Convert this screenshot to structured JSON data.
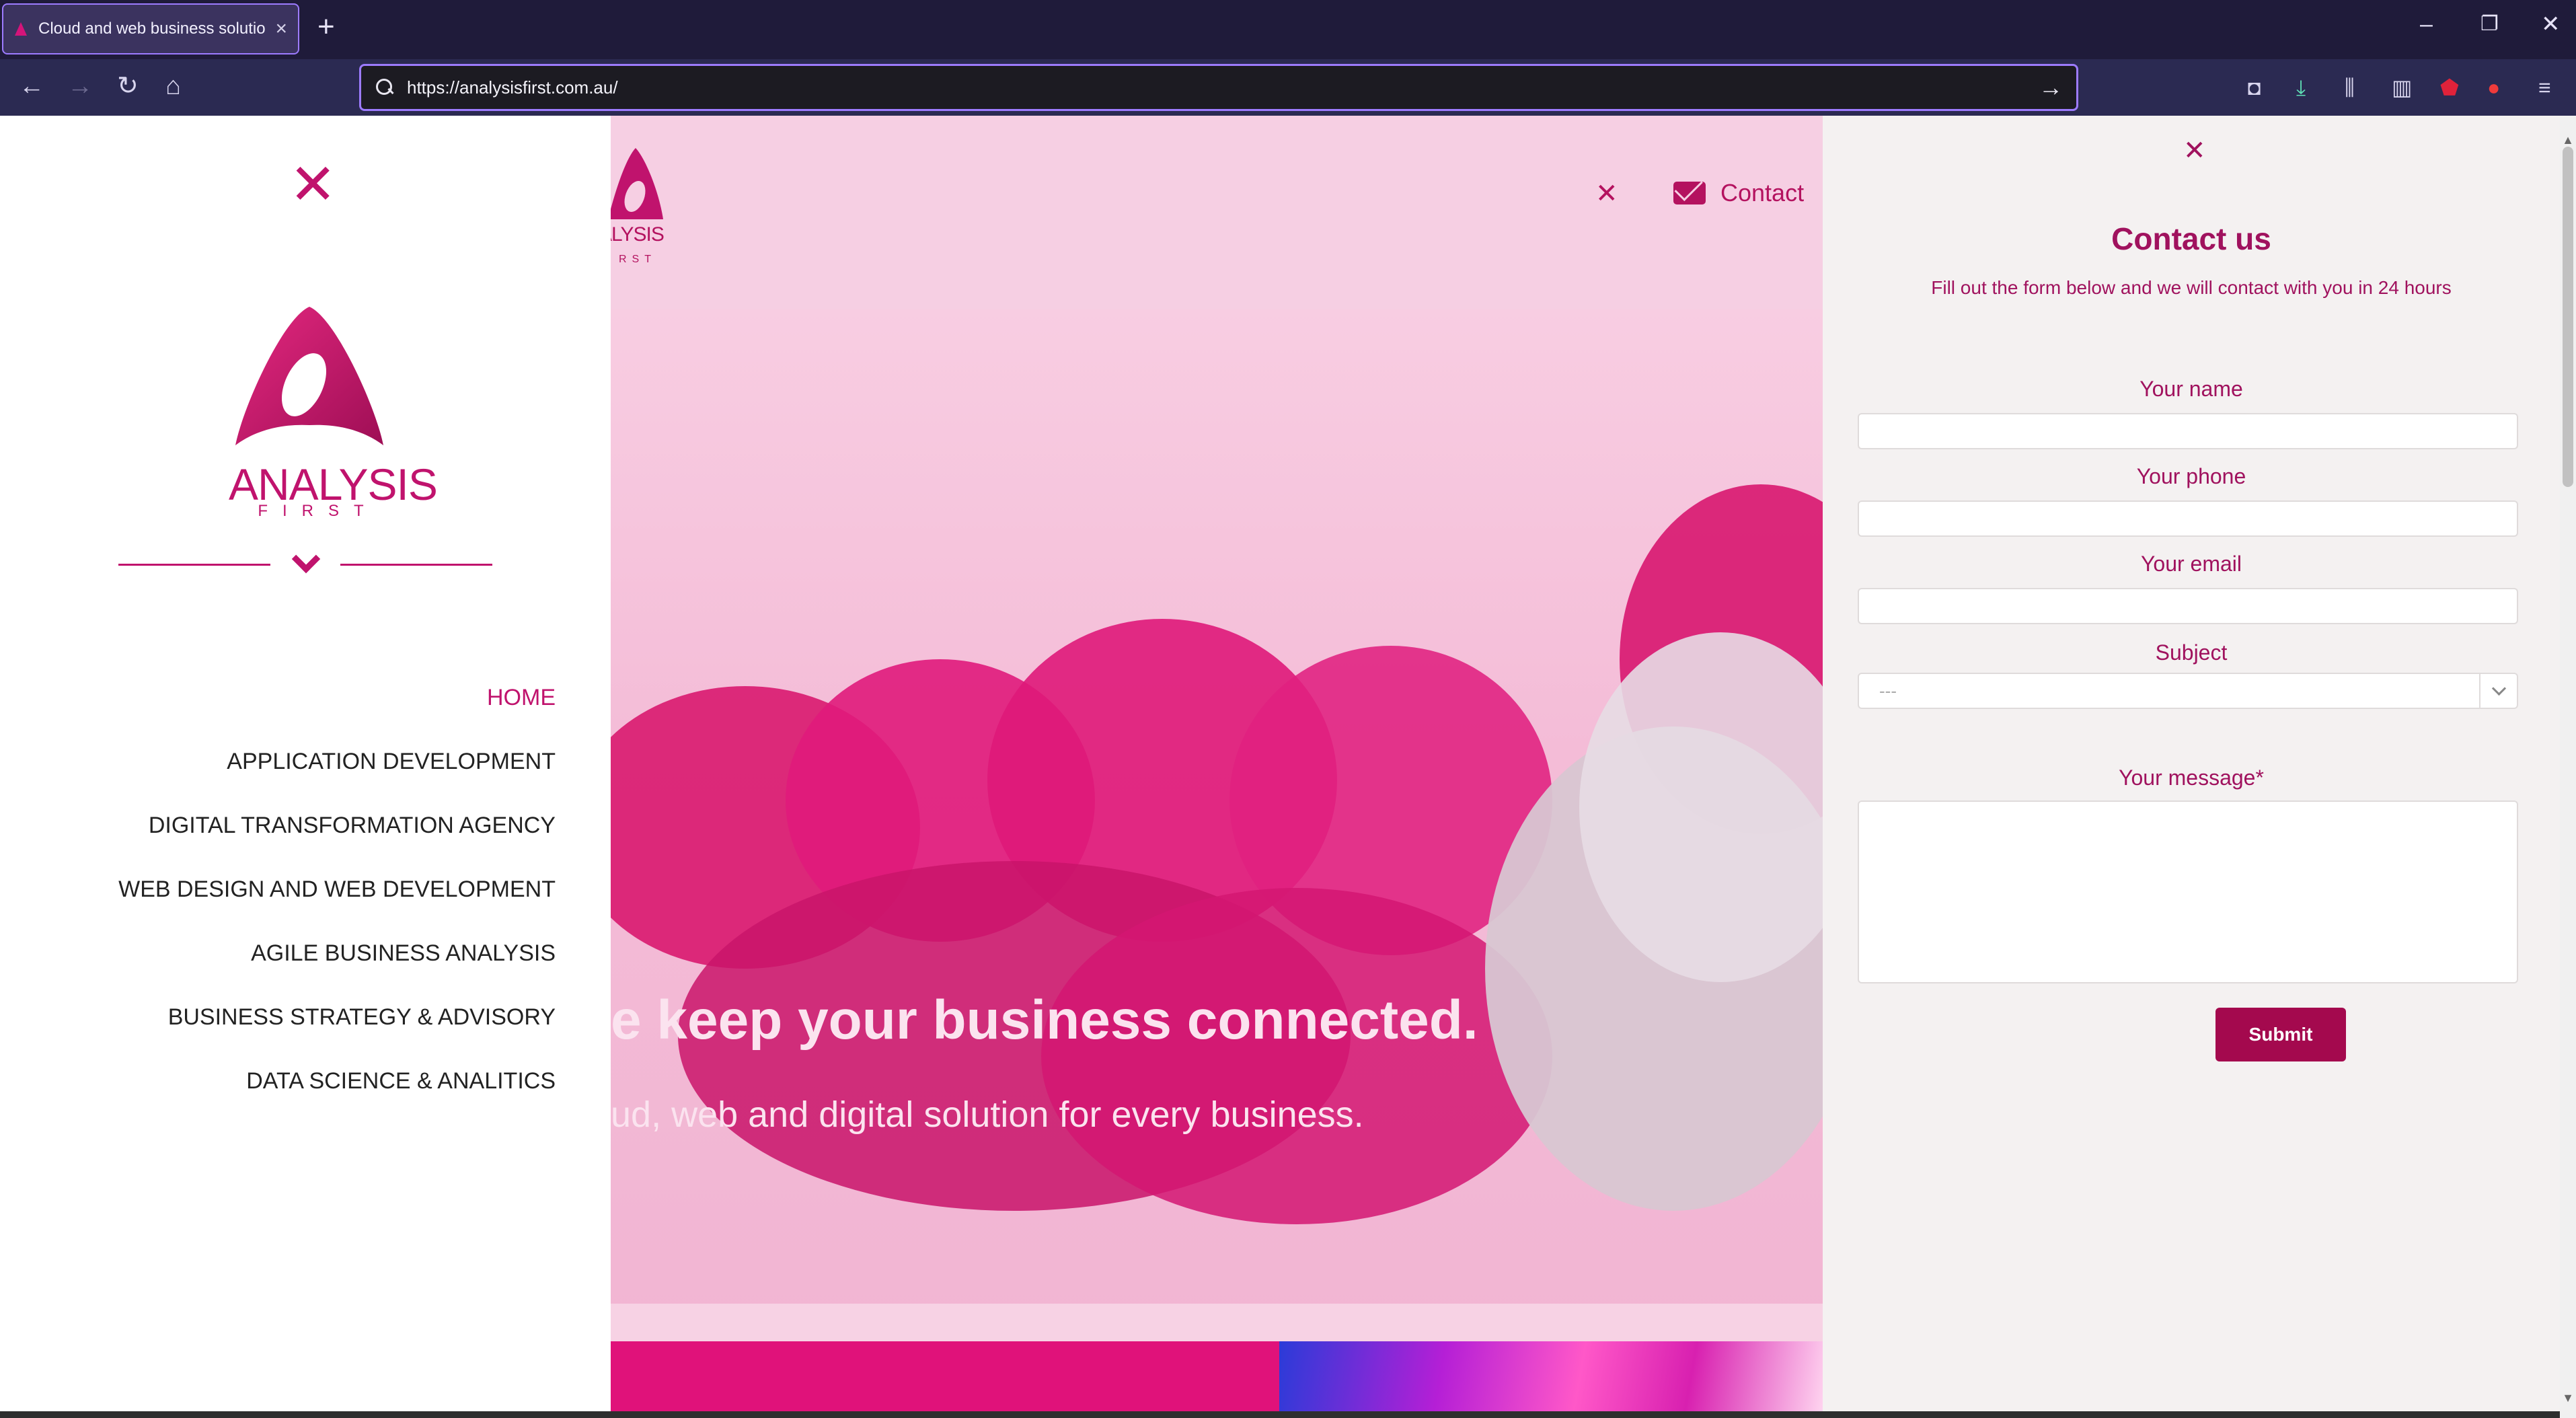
{
  "browser": {
    "tab_title": "Cloud and web business solutio",
    "tab_close": "×",
    "new_tab": "+",
    "url": "https://analysisfirst.com.au/",
    "window_controls": {
      "minimize": "–",
      "restore": "❐",
      "close": "✕"
    },
    "nav": {
      "back": "←",
      "forward": "→",
      "reload": "↻",
      "home": "⌂",
      "go": "→"
    },
    "toolbar_icons": [
      "pocket-icon",
      "download-icon",
      "library-icon",
      "sidebar-icon",
      "ublock-icon",
      "extension-icon",
      "menu-icon"
    ]
  },
  "left_nav": {
    "close": "✕",
    "brand": {
      "name": "ANALYSIS",
      "sub": "FIRST"
    },
    "items": [
      {
        "label": "HOME",
        "active": true
      },
      {
        "label": "APPLICATION DEVELOPMENT",
        "active": false
      },
      {
        "label": "DIGITAL TRANSFORMATION AGENCY",
        "active": false
      },
      {
        "label": "WEB DESIGN AND WEB DEVELOPMENT",
        "active": false
      },
      {
        "label": "AGILE BUSINESS ANALYSIS",
        "active": false
      },
      {
        "label": "BUSINESS STRATEGY & ADVISORY",
        "active": false
      },
      {
        "label": "DATA SCIENCE & ANALITICS",
        "active": false
      }
    ]
  },
  "hero": {
    "logo_fragment": "ALYSIS",
    "logo_sub_fragment": "RST",
    "close": "✕",
    "contact_label": "Contact",
    "headline": "e keep your business connected.",
    "subheadline": "ud, web and digital solution for every business."
  },
  "contact_form": {
    "close": "✕",
    "title": "Contact us",
    "subtitle": "Fill out the form below and we will contact with you in 24 hours",
    "name_label": "Your name",
    "phone_label": "Your phone",
    "email_label": "Your email",
    "subject_label": "Subject",
    "subject_value": "---",
    "message_label": "Your message*",
    "submit_label": "Submit"
  },
  "colors": {
    "brand": "#c0136d",
    "brand_dark": "#a0125e",
    "chrome_bg": "#1f1b3a",
    "url_border": "#9d7bff"
  }
}
